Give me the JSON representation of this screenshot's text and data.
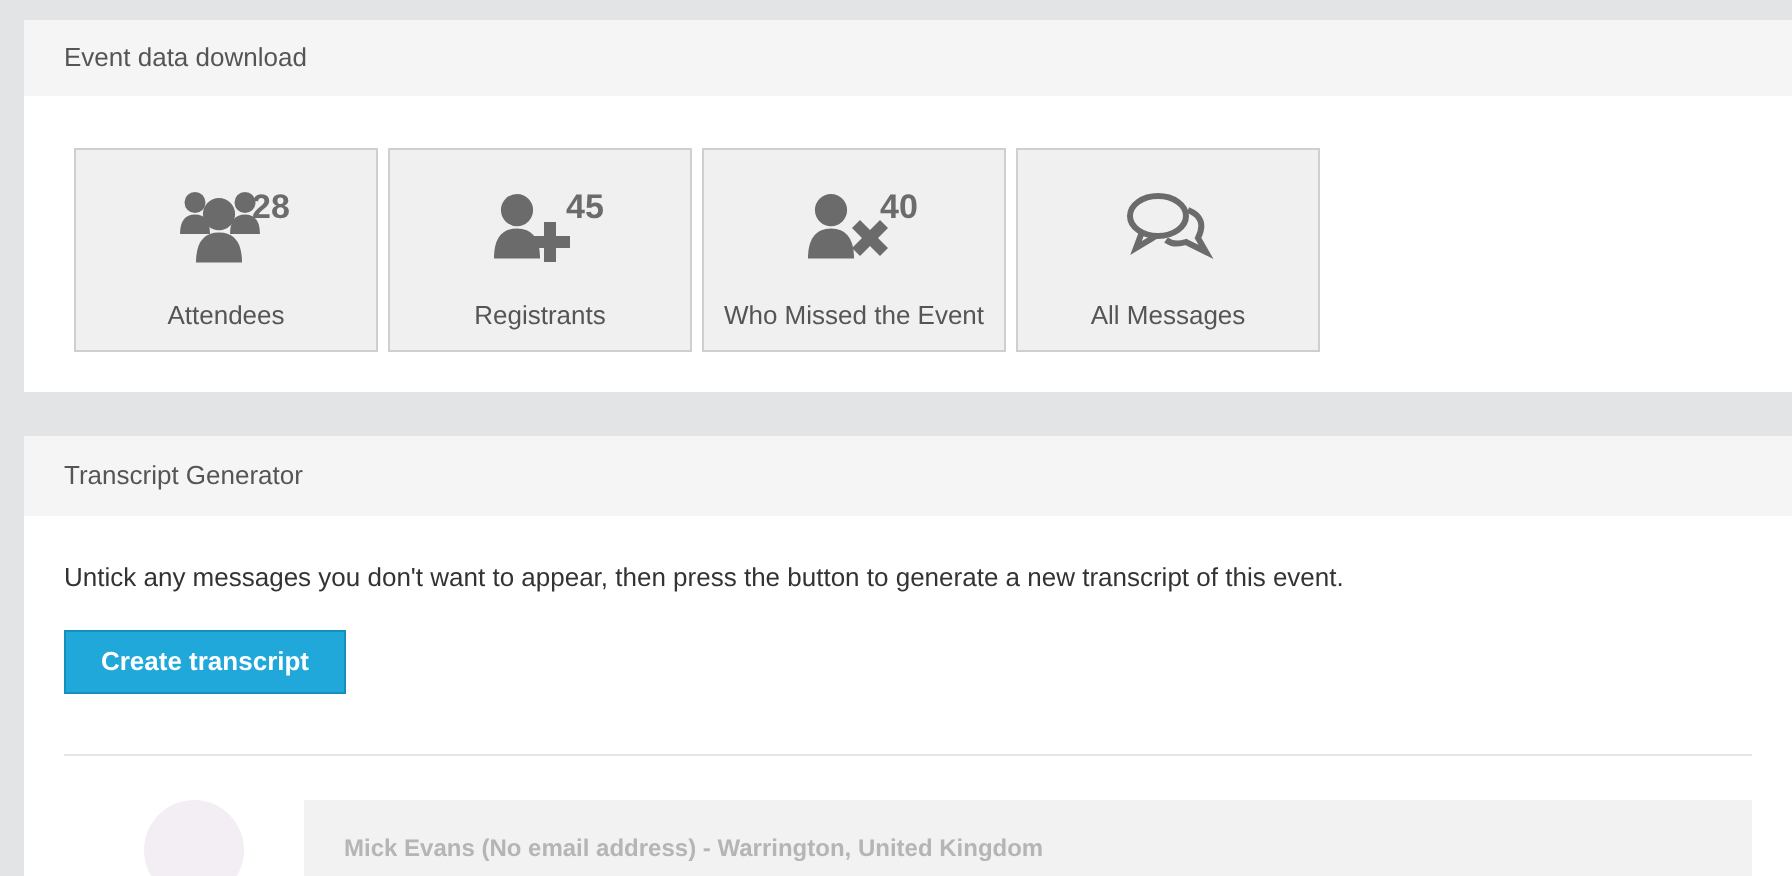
{
  "download_panel": {
    "title": "Event data download",
    "tiles": [
      {
        "kind": "attendees",
        "label": "Attendees",
        "count": "28"
      },
      {
        "kind": "registrants",
        "label": "Registrants",
        "count": "45"
      },
      {
        "kind": "missed",
        "label": "Who Missed the Event",
        "count": "40"
      },
      {
        "kind": "messages",
        "label": "All Messages"
      }
    ]
  },
  "transcript_panel": {
    "title": "Transcript Generator",
    "instructions": "Untick any messages you don't want to appear, then press the button to generate a new transcript of this event.",
    "button": "Create transcript",
    "messages": [
      {
        "author": "Mick Evans (No email address) - Warrington, United Kingdom"
      }
    ]
  }
}
